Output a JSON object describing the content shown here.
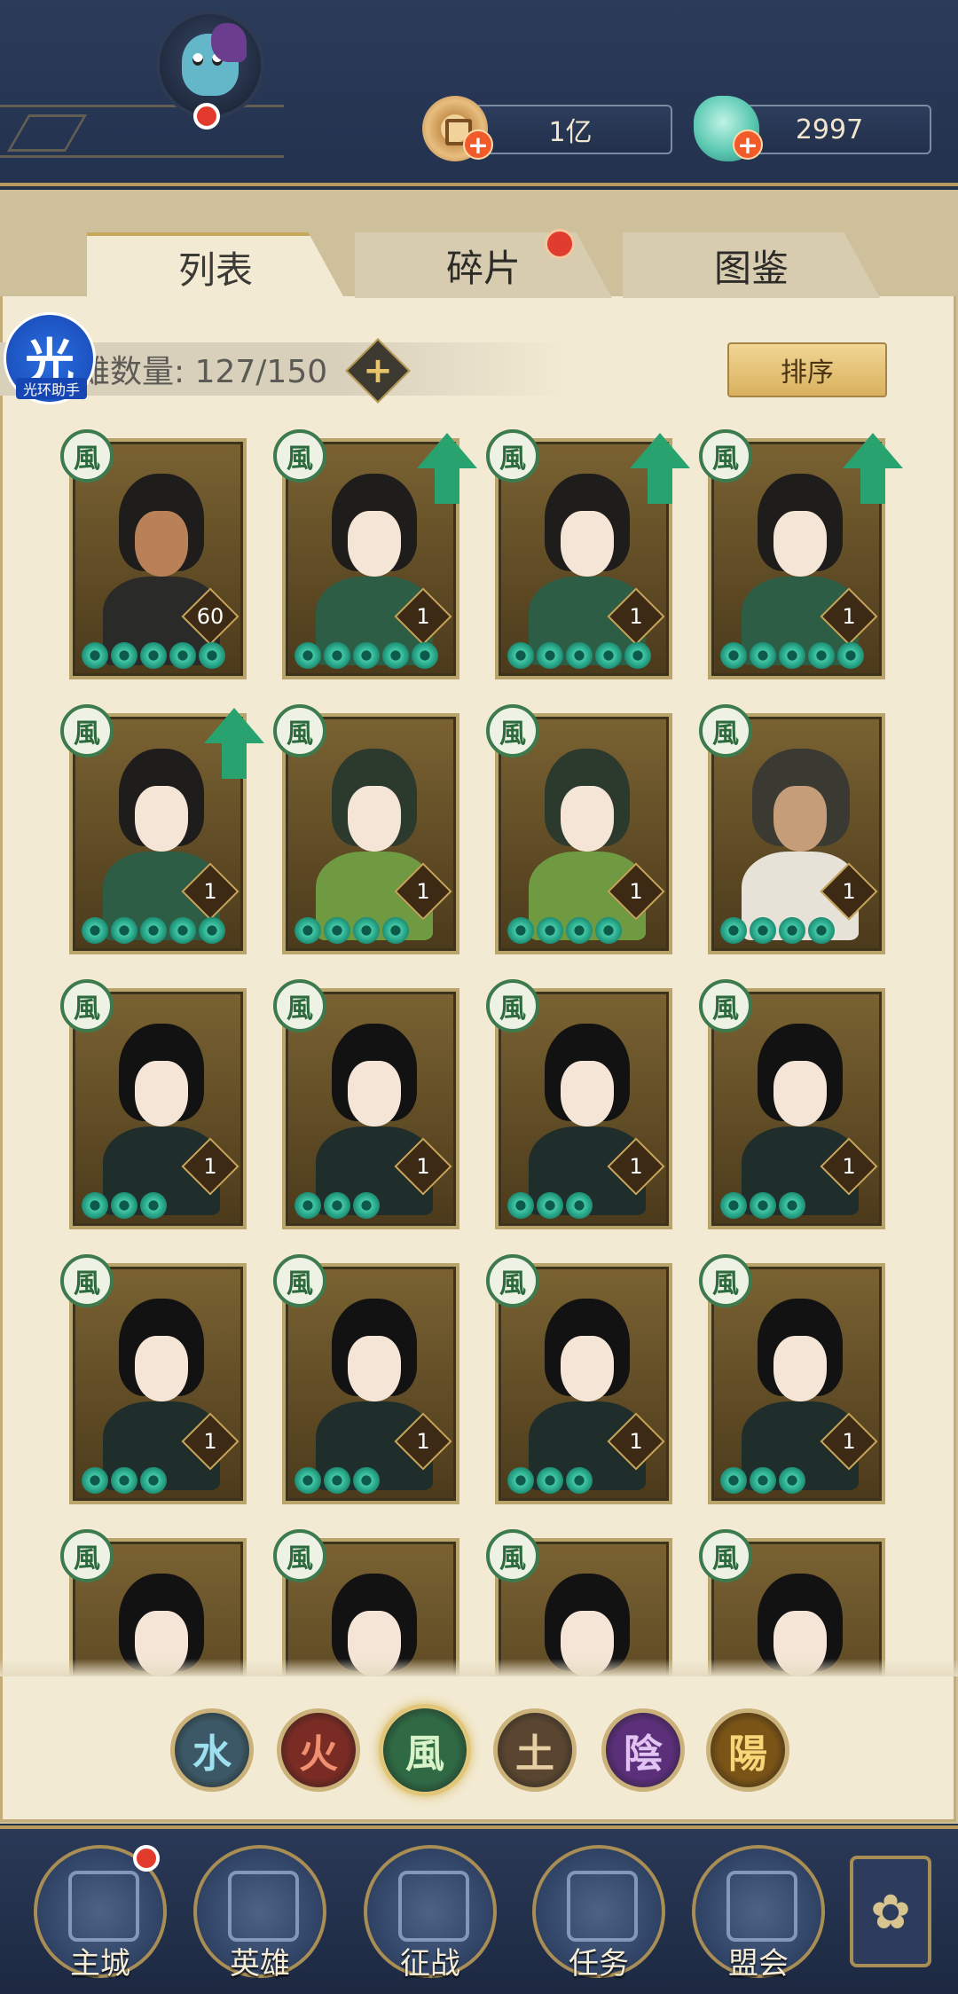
{
  "header": {
    "currencies": [
      {
        "name": "copper-coin",
        "value": "1亿"
      },
      {
        "name": "jade",
        "value": "2997"
      }
    ]
  },
  "tabs": [
    {
      "label": "列表",
      "active": true
    },
    {
      "label": "碎片",
      "active": false,
      "badge": true
    },
    {
      "label": "图鉴",
      "active": false
    }
  ],
  "toolbar": {
    "count_label": "雄数量: 127/150",
    "add_label": "+",
    "sort_label": "排序"
  },
  "assistant": {
    "icon_text": "光",
    "label": "光环助手"
  },
  "heroes": [
    {
      "element": "風",
      "level": "60",
      "stars": 5,
      "upgrade": false,
      "look": "ninja"
    },
    {
      "element": "風",
      "level": "1",
      "stars": 5,
      "upgrade": true,
      "look": "jade"
    },
    {
      "element": "風",
      "level": "1",
      "stars": 5,
      "upgrade": true,
      "look": "jade"
    },
    {
      "element": "風",
      "level": "1",
      "stars": 5,
      "upgrade": true,
      "look": "jade"
    },
    {
      "element": "風",
      "level": "1",
      "stars": 5,
      "upgrade": true,
      "look": "jade"
    },
    {
      "element": "風",
      "level": "1",
      "stars": 4,
      "upgrade": false,
      "look": "green"
    },
    {
      "element": "風",
      "level": "1",
      "stars": 4,
      "upgrade": false,
      "look": "green"
    },
    {
      "element": "風",
      "level": "1",
      "stars": 4,
      "upgrade": false,
      "look": "warrior"
    },
    {
      "element": "風",
      "level": "1",
      "stars": 3,
      "upgrade": false,
      "look": "dark"
    },
    {
      "element": "風",
      "level": "1",
      "stars": 3,
      "upgrade": false,
      "look": "dark"
    },
    {
      "element": "風",
      "level": "1",
      "stars": 3,
      "upgrade": false,
      "look": "dark"
    },
    {
      "element": "風",
      "level": "1",
      "stars": 3,
      "upgrade": false,
      "look": "dark"
    },
    {
      "element": "風",
      "level": "1",
      "stars": 3,
      "upgrade": false,
      "look": "dark"
    },
    {
      "element": "風",
      "level": "1",
      "stars": 3,
      "upgrade": false,
      "look": "dark"
    },
    {
      "element": "風",
      "level": "1",
      "stars": 3,
      "upgrade": false,
      "look": "dark"
    },
    {
      "element": "風",
      "level": "1",
      "stars": 3,
      "upgrade": false,
      "look": "dark"
    },
    {
      "element": "風",
      "level": "",
      "stars": 0,
      "upgrade": false,
      "look": "dark"
    },
    {
      "element": "風",
      "level": "",
      "stars": 0,
      "upgrade": false,
      "look": "dark"
    },
    {
      "element": "風",
      "level": "",
      "stars": 0,
      "upgrade": false,
      "look": "dark"
    },
    {
      "element": "風",
      "level": "",
      "stars": 0,
      "upgrade": false,
      "look": "dark"
    }
  ],
  "element_filters": [
    {
      "label": "水",
      "color": "#3c5866",
      "text": "#9fe0f0",
      "active": false
    },
    {
      "label": "火",
      "color": "#7a2b24",
      "text": "#f09070",
      "active": false
    },
    {
      "label": "風",
      "color": "#2f6a44",
      "text": "#d8f3c8",
      "active": true
    },
    {
      "label": "土",
      "color": "#5a4630",
      "text": "#e6cfa4",
      "active": false
    },
    {
      "label": "陰",
      "color": "#5b2f7a",
      "text": "#e2c4f2",
      "active": false
    },
    {
      "label": "陽",
      "color": "#7a5316",
      "text": "#f7d67a",
      "active": false
    }
  ],
  "bottom_nav": [
    {
      "label": "主城",
      "badge": true
    },
    {
      "label": "英雄",
      "badge": false
    },
    {
      "label": "征战",
      "badge": false
    },
    {
      "label": "任务",
      "badge": false
    },
    {
      "label": "盟会",
      "badge": false
    }
  ],
  "colors": {
    "panel": "#f3ead3",
    "header": "#2b3b5a",
    "accent_gold": "#b79a5c",
    "wind_green": "#3d7a4e"
  }
}
